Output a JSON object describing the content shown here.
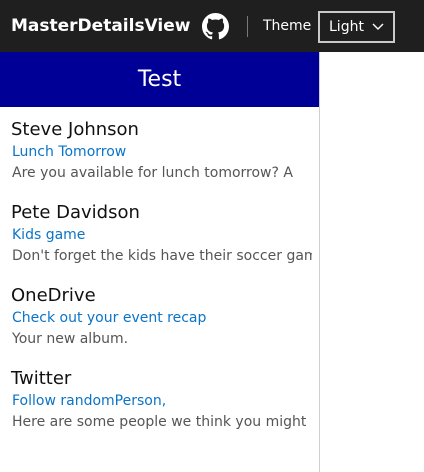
{
  "app": {
    "title": "MasterDetailsView",
    "github_icon": "github-icon",
    "theme_label": "Theme",
    "theme_value": "Light",
    "theme_chevron_icon": "chevron-down-icon",
    "colors": {
      "topbar": "#1f1f1f",
      "master_header": "#000096",
      "subject": "#0a74c8"
    }
  },
  "master": {
    "header": "Test",
    "items": [
      {
        "from": "Steve Johnson",
        "subject": "Lunch Tomorrow",
        "body": "Are you available for lunch tomorrow? A"
      },
      {
        "from": "Pete Davidson",
        "subject": "Kids game",
        "body": "Don't forget the kids have their soccer game"
      },
      {
        "from": "OneDrive",
        "subject": "Check out your event recap",
        "body": "Your new album."
      },
      {
        "from": "Twitter",
        "subject": "Follow randomPerson,",
        "body": "Here are some people we think you might"
      }
    ]
  }
}
